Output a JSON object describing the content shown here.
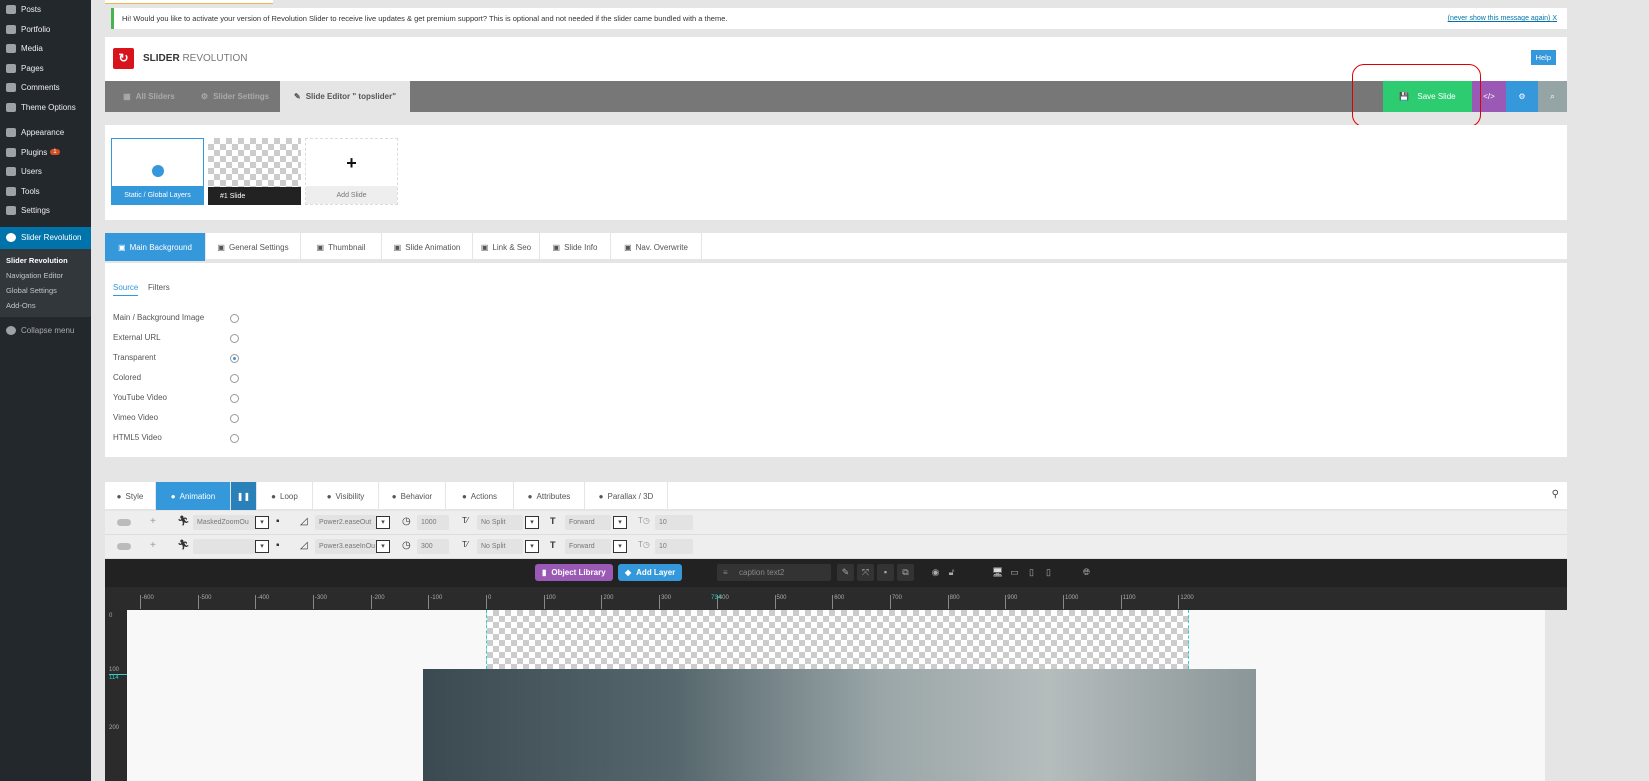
{
  "sidebar": {
    "items": [
      {
        "label": "Posts",
        "icon": "pin-icon"
      },
      {
        "label": "Portfolio",
        "icon": "portfolio-icon"
      },
      {
        "label": "Media",
        "icon": "media-icon"
      },
      {
        "label": "Pages",
        "icon": "pages-icon"
      },
      {
        "label": "Comments",
        "icon": "comment-icon"
      },
      {
        "label": "Theme Options",
        "icon": "theme-icon"
      },
      {
        "label": "Appearance",
        "icon": "brush-icon"
      },
      {
        "label": "Plugins",
        "icon": "plugin-icon",
        "badge": "1"
      },
      {
        "label": "Users",
        "icon": "user-icon"
      },
      {
        "label": "Tools",
        "icon": "wrench-icon"
      },
      {
        "label": "Settings",
        "icon": "settings-icon"
      }
    ],
    "active": "Slider Revolution",
    "sub": [
      "Slider Revolution",
      "Navigation Editor",
      "Global Settings",
      "Add-Ons"
    ],
    "collapse": "Collapse menu"
  },
  "notice": {
    "text": "Hi! Would you like to activate your version of Revolution Slider to receive live updates & get premium support? This is optional and not needed if the slider came bundled with a theme.",
    "dismiss": "(never show this message again)",
    "close": "X"
  },
  "header": {
    "brand_bold": "SLIDER",
    "brand_light": "REVOLUTION",
    "help": "Help"
  },
  "nav": {
    "all_sliders": "All Sliders",
    "slider_settings": "Slider Settings",
    "slide_editor": "Slide Editor \" topslider\"",
    "save": "Save Slide",
    "code": "</>",
    "colors": {
      "save": "#2ecc71",
      "code": "#9b59b6",
      "gear": "#3498db",
      "search": "#95a5a6"
    }
  },
  "slides": {
    "static": "Static / Global Layers",
    "slide1": "#1 Slide",
    "add": "Add Slide"
  },
  "bg_tabs": [
    "Main Background",
    "General Settings",
    "Thumbnail",
    "Slide Animation",
    "Link & Seo",
    "Slide Info",
    "Nav. Overwrite"
  ],
  "source": {
    "tabs": [
      "Source",
      "Filters"
    ],
    "options": [
      "Main / Background Image",
      "External URL",
      "Transparent",
      "Colored",
      "YouTube Video",
      "Vimeo Video",
      "HTML5 Video"
    ],
    "selected": "Transparent"
  },
  "layer_tabs": [
    "Style",
    "Animation",
    "Loop",
    "Visibility",
    "Behavior",
    "Actions",
    "Attributes",
    "Parallax / 3D"
  ],
  "anim_rows": [
    {
      "anim": "MaskedZoomOu",
      "ease": "Power2.easeOut",
      "duration": "1000",
      "split": "No Split",
      "direction": "Forward",
      "stagger": "10"
    },
    {
      "anim": "",
      "ease": "Power3.easeInOu",
      "duration": "300",
      "split": "No Split",
      "direction": "Forward",
      "stagger": "10"
    }
  ],
  "editor": {
    "object_library": "Object Library",
    "add_layer": "Add Layer",
    "layer_name": "caption text2"
  },
  "ruler": {
    "ticks": [
      -600,
      -500,
      -400,
      -300,
      -200,
      -100,
      0,
      100,
      200,
      300,
      400,
      500,
      600,
      700,
      800,
      900,
      1000,
      1100,
      1200
    ],
    "marker": "734",
    "v_ticks": [
      "0",
      "100",
      "200"
    ],
    "v_marker": "114"
  }
}
